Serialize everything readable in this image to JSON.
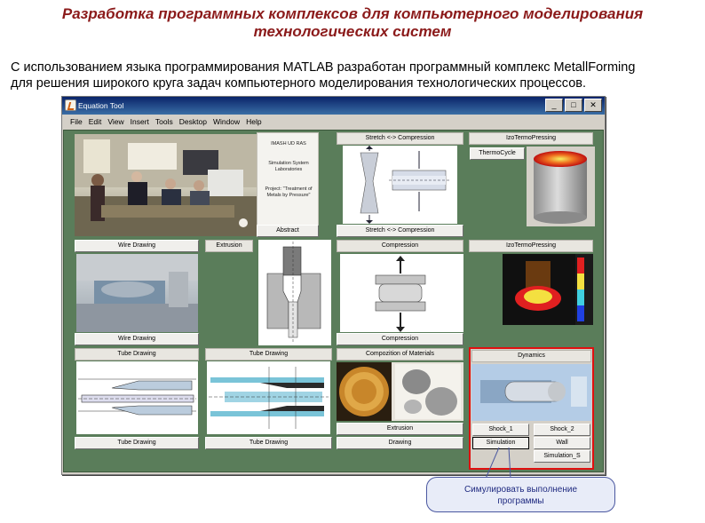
{
  "slide": {
    "title_line1": "Разработка программных комплексов для компьютерного моделирования",
    "title_line2": "технологических систем",
    "intro_line1": "С использованием языка программирования MATLAB разработан программный комплекс MetallForming",
    "intro_line2": "для решения широкого круга задач компьютерного моделирования технологических процессов."
  },
  "window": {
    "title": "Equation Tool",
    "minimize": "_",
    "maximize": "□",
    "close": "✕"
  },
  "menu": [
    "File",
    "Edit",
    "View",
    "Insert",
    "Tools",
    "Desktop",
    "Window",
    "Help"
  ],
  "info_box": {
    "line1": "IMASH  UD  RAS",
    "line2": "Simulation System",
    "line3": "Laboratories",
    "line4": "Project: \"Treatment of",
    "line5": "Metals by Pressure\""
  },
  "labels": {
    "abstract": "Abstract",
    "stretch_top": "Stretch <-> Compression",
    "stretch_bottom": "Stretch <-> Compression",
    "izo1": "IzoTermoPressing",
    "thermocycle": "ThermoCycle",
    "wire_top": "Wire Drawing",
    "wire_bottom": "Wire Drawing",
    "extrusion_top": "Extrusion",
    "compression_top": "Compression",
    "compression_bottom": "Compression",
    "izo2": "IzoTermoPressing",
    "tube1_top": "Tube Drawing",
    "tube1_bottom": "Tube Drawing",
    "tube2_top": "Tube Drawing",
    "tube2_bottom": "Tube Drawing",
    "materials_top": "Compozition of Materials",
    "materials_extrusion": "Extrusion",
    "materials_drawing": "Drawing",
    "dynamics": "Dynamics",
    "shock1": "Shock_1",
    "shock2": "Shock_2",
    "simulation": "Simulation",
    "wall": "Wall",
    "simulation_s": "Simulation_S"
  },
  "callout": {
    "line1": "Симулировать выполнение",
    "line2": "программы"
  },
  "colors": {
    "title": "#8b1a1a",
    "client_bg": "#5a7d5a",
    "highlight": "#e01010",
    "callout_border": "#4a57a0"
  }
}
